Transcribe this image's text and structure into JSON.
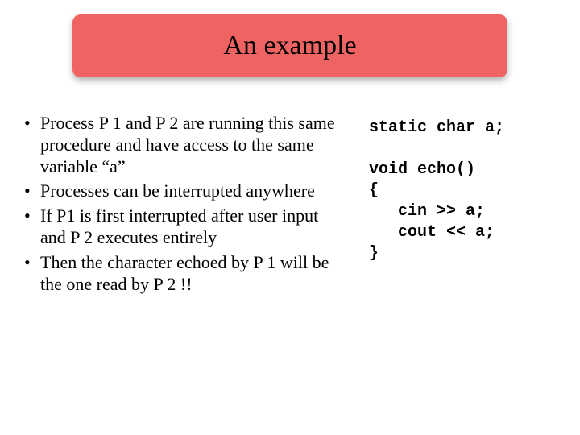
{
  "title": "An example",
  "bullets": [
    "Process P 1 and P 2 are running this same procedure and have access to the same variable “a”",
    "Processes can be interrupted anywhere",
    "If P1 is first interrupted after user input and P 2 executes entirely",
    "Then the character echoed by P 1 will be the one read by P 2 !!"
  ],
  "code": {
    "l1": "static char a;",
    "l2": "",
    "l3": "void echo()",
    "l4": "{",
    "l5": "   cin >> a;",
    "l6": "   cout << a;",
    "l7": "}"
  }
}
